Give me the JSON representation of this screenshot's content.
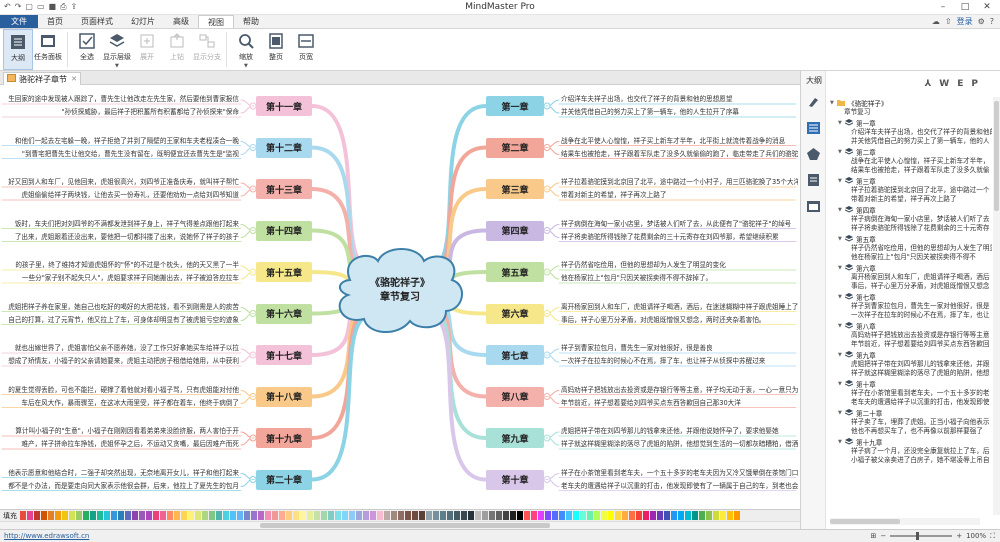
{
  "window": {
    "title": "MindMaster Pro",
    "login": "登录"
  },
  "menu": {
    "tabs": [
      "文件",
      "首页",
      "页面样式",
      "幻灯片",
      "高级",
      "视图",
      "帮助"
    ],
    "active_index": 5
  },
  "ribbon": {
    "buttons": [
      {
        "label": "大纲",
        "icon": "outline-icon",
        "active": true,
        "disabled": false,
        "caret": false
      },
      {
        "label": "任务面板",
        "icon": "task-panel-icon",
        "active": false,
        "disabled": false,
        "caret": false
      },
      {
        "label": "全选",
        "icon": "select-all-icon",
        "active": false,
        "disabled": false,
        "caret": false
      },
      {
        "label": "显示层级",
        "icon": "show-level-icon",
        "active": false,
        "disabled": false,
        "caret": true
      },
      {
        "label": "展开",
        "icon": "expand-icon",
        "active": false,
        "disabled": true,
        "caret": false
      },
      {
        "label": "上钻",
        "icon": "drill-up-icon",
        "active": false,
        "disabled": true,
        "caret": false
      },
      {
        "label": "显示分支",
        "icon": "show-branch-icon",
        "active": false,
        "disabled": true,
        "caret": false
      },
      {
        "label": "缩放",
        "icon": "zoom-icon",
        "active": false,
        "disabled": false,
        "caret": true
      },
      {
        "label": "整页",
        "icon": "fit-page-icon",
        "active": false,
        "disabled": false,
        "caret": false
      },
      {
        "label": "页宽",
        "icon": "page-width-icon",
        "active": false,
        "disabled": false,
        "caret": false
      }
    ]
  },
  "doc_tab": {
    "label": "骆驼祥子章节"
  },
  "map": {
    "central": {
      "line1": "《骆驼祥子》",
      "line2": "章节复习"
    },
    "right": [
      {
        "label": "第一章",
        "color": "#8dd3e6",
        "texts": [
          "介绍洋车夫祥子出场，也交代了祥子的背景和他的思想愿望",
          "并关他凭借自己的努力买上了第一辆车，他的人生拉开了序幕"
        ]
      },
      {
        "label": "第二章",
        "color": "#f2a69a",
        "texts": [
          "战争在北平使人心惶惶，祥子买上新车才半年，北平街上就流传着战争的消息",
          "结果车也被抢走，祥子跟着军队走了没多久就偷偷的跑了，临走带走了兵们的骆驼"
        ]
      },
      {
        "label": "第三章",
        "color": "#f9c98a",
        "texts": [
          "祥子拉着骆驼摸到北京回了北平，途中路过一个小村子，用三匹骆驼换了35个大洋",
          "带着对新主的希望，祥子再次上路了"
        ]
      },
      {
        "label": "第四章",
        "color": "#c9b8e2",
        "texts": [
          "祥子病倒在海甸一家小店里，梦话被人们听了去，从此便有了\"骆驼祥子\"的绰号",
          "祥子将卖骆驼所得钱除了花费剩余的三十元寄存在刘四爷那，希望继续积累"
        ]
      },
      {
        "label": "第五章",
        "color": "#bfe0a0",
        "texts": [
          "祥子仍然省吃俭用，但他的思想却为人发生了明显的变化",
          "他在杨家拉上\"包月\"只因关被拐卖得不得不辞掉了。"
        ]
      },
      {
        "label": "第六章",
        "color": "#f5e78a",
        "texts": [
          "离开杨家回到人和车厂，虎姐请祥子喝酒，酒后，在迷迷糊糊中祥子跟虎姐睡上了",
          "事后，祥子心里万分矛盾，对虎姐既憎恨又想念，两时还夹杂着害怕。"
        ]
      },
      {
        "label": "第七章",
        "color": "#a9d9ef",
        "texts": [
          "祥子到曹家拉包月，曹先生一家对他很好，很是善良",
          "一次祥子在拉车的时候心不在焉，摔了车，也让祥子从侦探中苏醒过来"
        ]
      },
      {
        "label": "第八章",
        "color": "#f4b0aa",
        "texts": [
          "高妈劝祥子把钱放出去投资或是存银行等等主意，祥子均无动于衷，一心一意只为",
          "年节前近，祥子想着要给刘四爷买点东西答歉回自己那30大洋"
        ]
      },
      {
        "label": "第九章",
        "color": "#a8e1d8",
        "texts": [
          "虎姐把祥子带在刘四爷那儿的钱拿来还他，并跟他说她怀孕了，要求他娶她",
          "祥子就这样糊里糊涂的落尽了虎姐的陷阱，他想觉到生活的一切都灰暗糟粕，借酒"
        ]
      },
      {
        "label": "第十章",
        "color": "#d9c7ea",
        "texts": [
          "祥子在小茶馆里看到老车夫，一个五十多岁的老车夫因为又冷又饿晕倒在茶馆门口",
          "老车夫的遭遇给祥子以沉重的打击，他发现即使有了一辆属于自己的车，到老也会"
        ]
      }
    ],
    "left": [
      {
        "label": "第十一章",
        "color": "#f4c2d8",
        "texts": [
          "生回家的途中发现被人跟踪了，曹先生让他改走左先生家，然后要他到曹家报信",
          "孙侦探威胁，最后祥子把积蓄所有积蓄都给了孙侦探来\"保命\""
        ]
      },
      {
        "label": "第十二章",
        "color": "#a9d9ef",
        "texts": [
          "和他们一起去左宅躲一晚，祥子拒绝了并到了隔壁的王家和车夫老程凑合一晚",
          "到曹宅把曹先生让他交给，曹先生没有留在，既明便宜还去曹先生是\"监视\""
        ]
      },
      {
        "label": "第十三章",
        "color": "#f4b0aa",
        "texts": [
          "好又回到人和车厂，见他回来，虎姐很高兴，刘四爷正准备庆寿，就叫祥子帮忙",
          "虎姐偷偷给祥子两块钱，让他去买一份寿礼，还要他劝劝一点给刘四爷知道"
        ]
      },
      {
        "label": "第十四章",
        "color": "#bfe0a0",
        "texts": [
          "饭时，车夫们把对刘四爷的不满都发泄到祥子身上，祥子气得差点跟他打起来",
          "了出来，虎姐跟着还没出来，要他把一切都抖搂了出来，说她怀了祥子的孩子"
        ]
      },
      {
        "label": "第十五章",
        "color": "#f5e78a",
        "texts": [
          "的孩子里，终了维持才知道虎姐怀的\"怀\"的不过是个枕头，他的天又黑了一半",
          "一些分\"家子别不起失只人\"，虎姐要求祥子同她搬出去，祥子被迫答应拉车"
        ]
      },
      {
        "label": "第十六章",
        "color": "#bfe0a0",
        "texts": [
          "虎姐把祥子养在家里，她自己也吃好的喝好的大把花钱，看不到刚需是人的痰苦",
          "自己的打算，过了元宵节，他又拉上了车，可身体却明显有了被虎姐亏空的迹象"
        ]
      },
      {
        "label": "第十七章",
        "color": "#f4c2d8",
        "texts": [
          "就也出嫁世界了，虎姐害怕父亲不愿养她，没了工作只好拿她买车给祥子以拉",
          "想成了矫情友，小福子的父亲请她要来，虎姐主动把房子租借给她用，从中获利"
        ]
      },
      {
        "label": "第十八章",
        "color": "#f9c98a",
        "texts": [
          "的夏生觉得丢脸，可也不能拦，硬撑了着他就对看小福子骂，只有虎姐能对付他",
          "车后在风大作，暴雨骤至，在这冰大雨里受，祥子都在着车，他终于病倒了"
        ]
      },
      {
        "label": "第十九章",
        "color": "#f2a69a",
        "texts": [
          "算计叫小福子的\"生意\"，小福子在刚刚因看着弟弟来没脸挤服，两人害怕于开",
          "难产，祥子拼命拉车挣钱，虎姐怀孕之后，不运动又贪嘴，最后因难产而死"
        ]
      },
      {
        "label": "第二十章",
        "color": "#8dd3e6",
        "texts": [
          "他表示愿意和他结合时，二强子却突然出现，无奈地离开女儿，祥子和他打起来",
          "都不是个办法，而是要走向同大家表示他很会群，后来，他拉上了夏先生的包月"
        ]
      }
    ]
  },
  "palette": {
    "label": "填充",
    "colors": [
      "#e74c3c",
      "#e84393",
      "#c0392b",
      "#d35400",
      "#e67e22",
      "#f39c12",
      "#f1c40f",
      "#d4e157",
      "#9ccc65",
      "#27ae60",
      "#16a085",
      "#1abc9c",
      "#26c6da",
      "#3498db",
      "#2980b9",
      "#5c6bc0",
      "#8e44ad",
      "#9b59b6",
      "#ab47bc",
      "#ec407a",
      "#f06292",
      "#ff8a65",
      "#ffb74d",
      "#ffd54f",
      "#fff176",
      "#dce775",
      "#aed581",
      "#81c784",
      "#4db6ac",
      "#4dd0e1",
      "#4fc3f7",
      "#64b5f6",
      "#7986cb",
      "#9575cd",
      "#ba68c8",
      "#f48fb1",
      "#ef9a9a",
      "#ffab91",
      "#ffcc80",
      "#ffe082",
      "#fff59d",
      "#e6ee9c",
      "#c5e1a5",
      "#a5d6a7",
      "#80cbc4",
      "#80deea",
      "#81d4fa",
      "#90caf9",
      "#9fa8da",
      "#b39ddb",
      "#ce93d8",
      "#f8bbd0",
      "#bcaaa4",
      "#a1887f",
      "#8d6e63",
      "#795548",
      "#6d4c41",
      "#5d4037",
      "#90a4ae",
      "#78909c",
      "#607d8b",
      "#546e7a",
      "#455a64",
      "#37474f",
      "#263238",
      "#bdbdbd",
      "#9e9e9e",
      "#757575",
      "#616161",
      "#424242",
      "#212121",
      "#000000",
      "#ff5252",
      "#ff4081",
      "#e040fb",
      "#7c4dff",
      "#536dfe",
      "#448aff",
      "#40c4ff",
      "#18ffff",
      "#64ffda",
      "#69f0ae",
      "#b2ff59",
      "#eeff41",
      "#ffff00",
      "#ffd740",
      "#ffab40",
      "#ff6e40",
      "#f44336",
      "#e91e63",
      "#9c27b0",
      "#673ab7",
      "#3f51b5",
      "#2196f3",
      "#03a9f4",
      "#00bcd4",
      "#009688",
      "#4caf50",
      "#8bc34a",
      "#cddc39",
      "#ffeb3b",
      "#ffc107",
      "#ff9800"
    ]
  },
  "status": {
    "url": "http://www.edrawsoft.cn",
    "zoom": "100%"
  },
  "outline_panel": {
    "header": "大纲",
    "tools": [
      "⅄",
      "W",
      "E",
      "P"
    ]
  },
  "outline": {
    "root": "《骆驼祥子》",
    "root_sub": "章节复习",
    "items": [
      {
        "title": "第一章",
        "lines": [
          "介绍洋车夫祥子出场，也交代了祥子的背景和他的思",
          "并关他凭借自己的努力买上了第一辆车，他的人"
        ]
      },
      {
        "title": "第二章",
        "lines": [
          "战争在北平使人心惶惶，祥子买上新车才半年，",
          "结果车也被抢走，祥子跟着军队走了没多久就偷"
        ]
      },
      {
        "title": "第三章",
        "lines": [
          "祥子拉着骆驼摸到北京回了北平，途中路过一个",
          "带着对新主的希望，祥子再次上路了"
        ]
      },
      {
        "title": "第四章",
        "lines": [
          "祥子病倒在海甸一家小店里，梦话被人们听了去",
          "祥子将卖骆驼所得钱除了花费剩余的三十元寄存"
        ]
      },
      {
        "title": "第五章",
        "lines": [
          "祥子仍然省吃俭用，但他的思想却为人发生了明显",
          "他在杨家拉上\"包月\"只因关被拐卖得不得不"
        ]
      },
      {
        "title": "第六章",
        "lines": [
          "离开杨家回到人和车厂，虎姐请祥子喝酒，酒后",
          "事后，祥子心里万分矛盾，对虎姐既憎恨又想念"
        ]
      },
      {
        "title": "第七章",
        "lines": [
          "祥子到曹家拉包月，曹先生一家对他很好，很是",
          "一次祥子在拉车的时候心不在焉，摔了车，也让"
        ]
      },
      {
        "title": "第八章",
        "lines": [
          "高妈劝祥子把钱放出去投资或是存银行等等主意",
          "年节前近，祥子想着要给刘四爷买点东西答歉回"
        ]
      },
      {
        "title": "第九章",
        "lines": [
          "虎姐把祥子带在刘四爷那儿的钱拿来还他，并跟",
          "祥子就这样糊里糊涂的落尽了虎姐的陷阱，他想"
        ]
      },
      {
        "title": "第十章",
        "lines": [
          "祥子在小茶馆里看到老车夫，一个五十多岁的老",
          "老车夫的遭遇给祥子以沉重的打击，他发现即使"
        ]
      },
      {
        "title": "第二十章",
        "lines": [
          "祥子卖了车，埋葬了虎姐。正当小福子向他表示",
          "他也不再想买车了，也不再像以前那样要强了"
        ]
      },
      {
        "title": "第十九章",
        "lines": [
          "祥子病了一个月，还没完全康复就拉上了车，后",
          "小福子被父亲卖进了白房子，她不堪凌辱上吊自"
        ]
      }
    ]
  }
}
